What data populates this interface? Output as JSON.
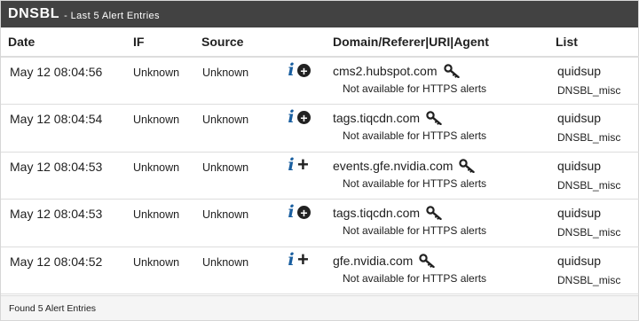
{
  "panel": {
    "title": "DNSBL",
    "subtitle": "- Last 5 Alert Entries"
  },
  "columns": {
    "date": "Date",
    "if": "IF",
    "source": "Source",
    "domain": "Domain/Referer|URI|Agent",
    "list": "List"
  },
  "rows": [
    {
      "date": "May 12 08:04:56",
      "if": "Unknown",
      "source": "Unknown",
      "action_icon": "add-circle-icon",
      "domain": "cms2.hubspot.com",
      "note": "Not available for HTTPS alerts",
      "list": "quidsup",
      "group": "DNSBL_misc"
    },
    {
      "date": "May 12 08:04:54",
      "if": "Unknown",
      "source": "Unknown",
      "action_icon": "add-circle-icon",
      "domain": "tags.tiqcdn.com",
      "note": "Not available for HTTPS alerts",
      "list": "quidsup",
      "group": "DNSBL_misc"
    },
    {
      "date": "May 12 08:04:53",
      "if": "Unknown",
      "source": "Unknown",
      "action_icon": "plus-icon",
      "domain": "events.gfe.nvidia.com",
      "note": "Not available for HTTPS alerts",
      "list": "quidsup",
      "group": "DNSBL_misc"
    },
    {
      "date": "May 12 08:04:53",
      "if": "Unknown",
      "source": "Unknown",
      "action_icon": "add-circle-icon",
      "domain": "tags.tiqcdn.com",
      "note": "Not available for HTTPS alerts",
      "list": "quidsup",
      "group": "DNSBL_misc"
    },
    {
      "date": "May 12 08:04:52",
      "if": "Unknown",
      "source": "Unknown",
      "action_icon": "plus-icon",
      "domain": "gfe.nvidia.com",
      "note": "Not available for HTTPS alerts",
      "list": "quidsup",
      "group": "DNSBL_misc"
    }
  ],
  "footer": {
    "text": "Found 5 Alert Entries"
  },
  "colors": {
    "header_bg": "#424242",
    "info_icon": "#1a5fa0",
    "footer_bg": "#f5f5f5"
  }
}
